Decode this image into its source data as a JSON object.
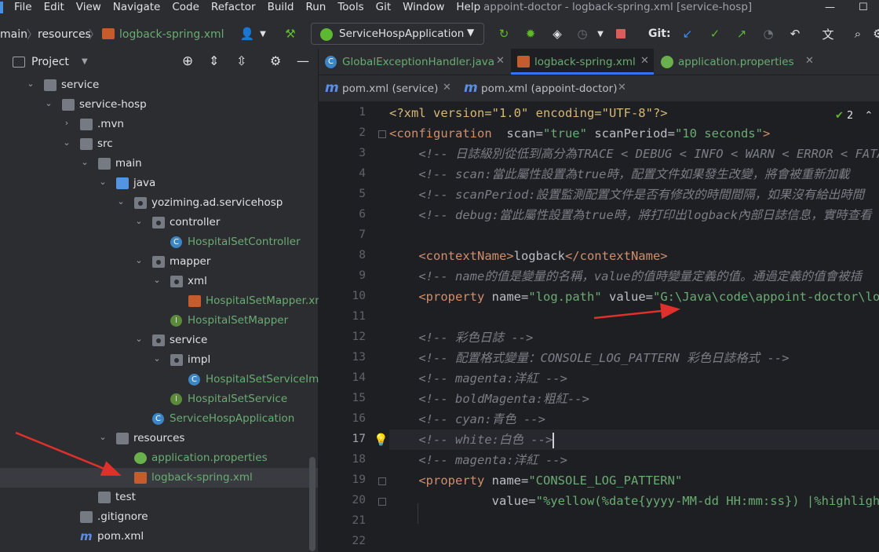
{
  "menubar": {
    "items": [
      "File",
      "Edit",
      "View",
      "Navigate",
      "Code",
      "Refactor",
      "Build",
      "Run",
      "Tools",
      "Git",
      "Window",
      "Help"
    ],
    "window_title": "appoint-doctor - logback-spring.xml [service-hosp]"
  },
  "toolbar": {
    "breadcrumbs": [
      "main",
      "resources",
      "logback-spring.xml"
    ],
    "run_config": "ServiceHospApplication",
    "git_label": "Git:"
  },
  "project_panel": {
    "title": "Project",
    "tree": [
      {
        "label": "service",
        "icon": "module-folder-icon",
        "color": "#dfe1e5"
      },
      {
        "label": "service-hosp",
        "icon": "module-folder-icon",
        "color": "#dfe1e5"
      },
      {
        "label": ".mvn",
        "icon": "folder-icon",
        "color": "#dfe1e5"
      },
      {
        "label": "src",
        "icon": "folder-icon",
        "color": "#dfe1e5"
      },
      {
        "label": "main",
        "icon": "folder-icon",
        "color": "#dfe1e5"
      },
      {
        "label": "java",
        "icon": "source-folder-icon",
        "color": "#dfe1e5"
      },
      {
        "label": "yoziming.ad.servicehosp",
        "icon": "package-icon",
        "color": "#dfe1e5"
      },
      {
        "label": "controller",
        "icon": "package-icon",
        "color": "#dfe1e5"
      },
      {
        "label": "HospitalSetController",
        "icon": "class-icon",
        "color": "#6aab73"
      },
      {
        "label": "mapper",
        "icon": "package-icon",
        "color": "#dfe1e5"
      },
      {
        "label": "xml",
        "icon": "package-icon",
        "color": "#dfe1e5"
      },
      {
        "label": "HospitalSetMapper.xml",
        "icon": "xml-file-icon",
        "color": "#6aab73"
      },
      {
        "label": "HospitalSetMapper",
        "icon": "interface-icon",
        "color": "#6aab73"
      },
      {
        "label": "service",
        "icon": "package-icon",
        "color": "#dfe1e5"
      },
      {
        "label": "impl",
        "icon": "package-icon",
        "color": "#dfe1e5"
      },
      {
        "label": "HospitalSetServiceImp",
        "icon": "class-icon",
        "color": "#6aab73"
      },
      {
        "label": "HospitalSetService",
        "icon": "interface-icon",
        "color": "#6aab73"
      },
      {
        "label": "ServiceHospApplication",
        "icon": "spring-boot-class-icon",
        "color": "#6aab73"
      },
      {
        "label": "resources",
        "icon": "resources-folder-icon",
        "color": "#dfe1e5"
      },
      {
        "label": "application.properties",
        "icon": "spring-properties-icon",
        "color": "#6aab73"
      },
      {
        "label": "logback-spring.xml",
        "icon": "xml-file-icon",
        "color": "#6aab73"
      },
      {
        "label": "test",
        "icon": "folder-icon",
        "color": "#dfe1e5"
      },
      {
        "label": ".gitignore",
        "icon": "git-file-icon",
        "color": "#dfe1e5"
      },
      {
        "label": "pom.xml",
        "icon": "maven-icon",
        "color": "#dfe1e5"
      }
    ]
  },
  "editor": {
    "tabs_row1": [
      {
        "label": "GlobalExceptionHandler.java",
        "icon": "class-icon",
        "color": "#6aab73"
      },
      {
        "label": "logback-spring.xml",
        "icon": "xml-file-icon",
        "color": "#6aab73"
      },
      {
        "label": "application.properties",
        "icon": "spring-properties-icon",
        "color": "#6aab73"
      }
    ],
    "tabs_row2": [
      {
        "label": "pom.xml (service)",
        "icon": "maven-icon",
        "color": "#bcbec4"
      },
      {
        "label": "pom.xml (appoint-doctor)",
        "icon": "maven-icon",
        "color": "#bcbec4"
      }
    ],
    "inspection_count": "2",
    "line_numbers": [
      "1",
      "2",
      "3",
      "4",
      "5",
      "6",
      "7",
      "8",
      "9",
      "10",
      "11",
      "12",
      "13",
      "14",
      "15",
      "16",
      "17",
      "18",
      "19",
      "20",
      "21",
      "22"
    ],
    "current_line": "17",
    "code": {
      "l1_decl": "<?xml version=\"1.0\" encoding=\"UTF-8\"?>",
      "l2_tag": "<configuration",
      "l2_a1": "  scan=",
      "l2_v1": "\"true\"",
      "l2_a2": " scanPeriod=",
      "l2_v2": "\"10 seconds\"",
      "l2_end": ">",
      "l3": "    <!-- 日誌級別從低到高分為TRACE < DEBUG < INFO < WARN < ERROR < FATAL",
      "l4": "    <!-- scan:當此屬性設置為true時，配置文件如果發生改變，將會被重新加載",
      "l5": "    <!-- scanPeriod:設置監測配置文件是否有修改的時間間隔，如果沒有給出時間",
      "l6": "    <!-- debug:當此屬性設置為true時，將打印出logback內部日誌信息，實時查看",
      "l8_open": "    <contextName>",
      "l8_txt": "logback",
      "l8_close": "</contextName>",
      "l9": "    <!-- name的值是變量的名稱，value的值時變量定義的值。通過定義的值會被插",
      "l10_tag": "    <property",
      "l10_a1": " name=",
      "l10_v1": "\"log.path\"",
      "l10_a2": " value=",
      "l10_v2": "\"G:\\Java\\code\\appoint-doctor\\log\"",
      "l12": "    <!-- 彩色日誌 -->",
      "l13": "    <!-- 配置格式變量：CONSOLE_LOG_PATTERN 彩色日誌格式 -->",
      "l14": "    <!-- magenta:洋紅 -->",
      "l15": "    <!-- boldMagenta:粗紅-->",
      "l16": "    <!-- cyan:青色 -->",
      "l17": "    <!-- white:白色 -->",
      "l18": "    <!-- magenta:洋紅 -->",
      "l19_tag": "    <property",
      "l19_a1": " name=",
      "l19_v1": "\"CONSOLE_LOG_PATTERN\"",
      "l20_a1": "              value=",
      "l20_v1": "\"%yellow(%date{yyyy-MM-dd HH:mm:ss}) |%highlight(%"
    }
  },
  "colors": {
    "accent": "#3574f0",
    "annotation_arrow": "#e0302b"
  }
}
